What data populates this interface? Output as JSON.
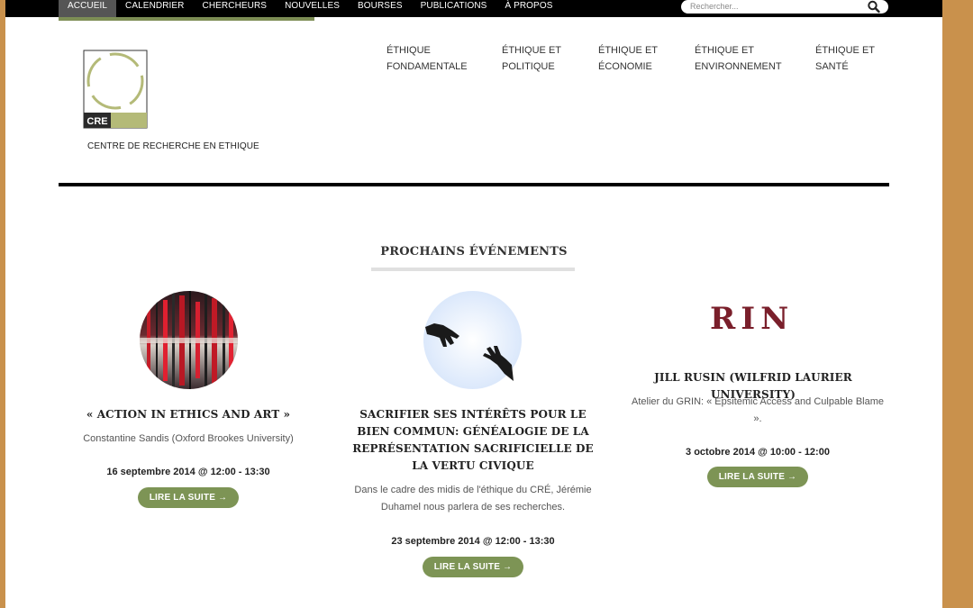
{
  "topnav": {
    "items": [
      "ACCUEIL",
      "CALENDRIER",
      "CHERCHEURS",
      "NOUVELLES",
      "BOURSES",
      "PUBLICATIONS",
      "À PROPOS"
    ],
    "active": "ACCUEIL"
  },
  "search": {
    "placeholder": "Rechercher..."
  },
  "logo": {
    "badge": "CRE",
    "caption": "CENTRE DE RECHERCHE EN ETHIQUE"
  },
  "mainnav": [
    {
      "line1": "ÉTHIQUE",
      "line2": "FONDAMENTALE"
    },
    {
      "line1": "ÉTHIQUE ET",
      "line2": "POLITIQUE"
    },
    {
      "line1": "ÉTHIQUE ET",
      "line2": "ÉCONOMIE"
    },
    {
      "line1": "ÉTHIQUE ET",
      "line2": "ENVIRONNEMENT"
    },
    {
      "line1": "ÉTHIQUE ET",
      "line2": "SANTÉ"
    }
  ],
  "section": {
    "title": "PROCHAINS ÉVÉNEMENTS"
  },
  "events": [
    {
      "title": "« ACTION IN ETHICS AND ART »",
      "description": "Constantine Sandis (Oxford Brookes University)",
      "date": "16 septembre 2014 @ 12:00 - 13:30",
      "button": "LIRE LA SUITE →"
    },
    {
      "title": "SACRIFIER SES INTÉRÊTS POUR LE BIEN COMMUN: GÉNÉALOGIE DE LA REPRÉSENTATION SACRIFICIELLE DE LA VERTU CIVIQUE",
      "description": "Dans le cadre des midis de l'éthique du CRÉ, Jérémie Duhamel nous parlera de ses recherches.",
      "date": "23 septembre 2014 @ 12:00 - 13:30",
      "button": "LIRE LA SUITE →"
    },
    {
      "title": "JILL RUSIN (WILFRID LAURIER UNIVERSITY)",
      "description": "Atelier du GRIN: « Epsitemic Access and Culpable Blame ».",
      "date": "3 octobre 2014 @ 10:00 - 12:00",
      "button": "LIRE LA SUITE →",
      "image_text": "RIN"
    }
  ],
  "colors": {
    "accent": "#7d8e55",
    "button": "#7d9455",
    "logo_green": "#b4ba78",
    "grin_red": "#7a1f2b",
    "background": "#c9914c"
  }
}
